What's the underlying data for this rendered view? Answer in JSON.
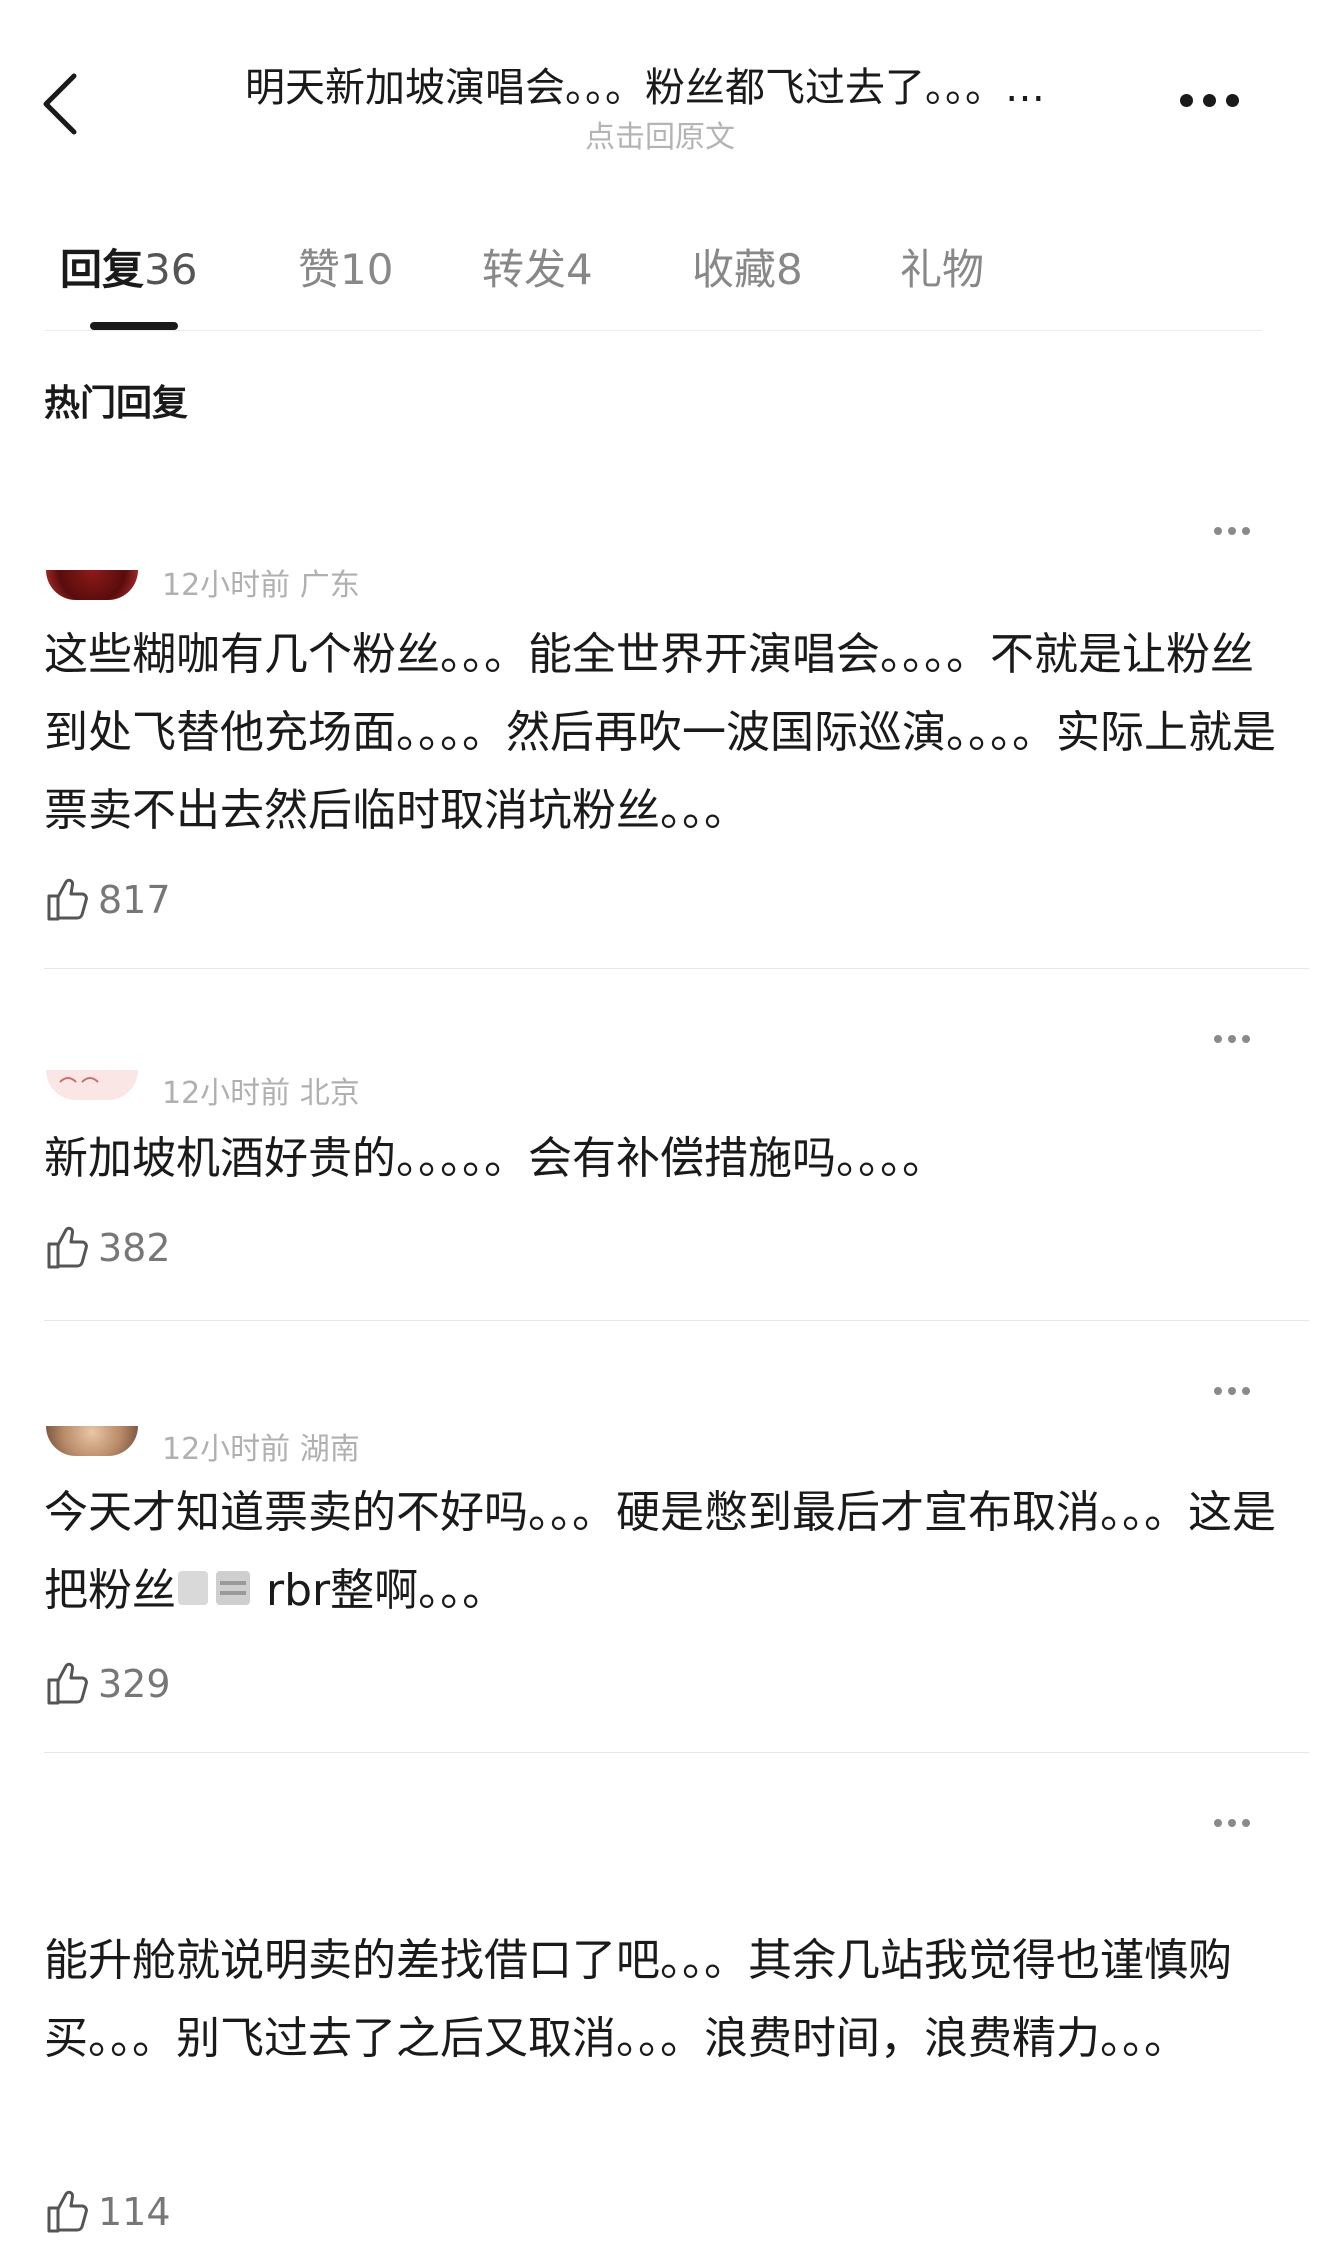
{
  "header": {
    "title": "明天新加坡演唱会。。。粉丝都飞过去了。。。…",
    "subtitle": "点击回原文"
  },
  "tabs": [
    {
      "label": "回复",
      "count": "36"
    },
    {
      "label": "赞",
      "count": "10"
    },
    {
      "label": "转发",
      "count": "4"
    },
    {
      "label": "收藏",
      "count": "8"
    },
    {
      "label": "礼物",
      "count": ""
    }
  ],
  "section_title": "热门回复",
  "comments": [
    {
      "meta": "12小时前  广东",
      "text": "这些糊咖有几个粉丝。。。能全世界开演唱会。。。。不就是让粉丝到处飞替他充场面。。。。然后再吹一波国际巡演。。。。实际上就是票卖不出去然后临时取消坑粉丝。。。",
      "likes": "817"
    },
    {
      "meta": "12小时前  北京",
      "text": "新加坡机酒好贵的。。。。。会有补偿措施吗。。。。",
      "likes": "382"
    },
    {
      "meta": "12小时前  湖南",
      "text_before": "今天才知道票卖的不好吗。。。硬是憋到最后才宣布取消。。。这是把粉丝",
      "text_after": " rbr整啊。。。",
      "likes": "329"
    },
    {
      "meta": "",
      "text": "能升舱就说明卖的差找借口了吧。。。其余几站我觉得也谨慎购买。。。别飞过去了之后又取消。。。浪费时间，浪费精力。。。",
      "likes": "114"
    }
  ],
  "icons": {
    "back": "chevron-left-icon",
    "more": "more-dots-icon",
    "like": "thumbs-up-icon"
  },
  "colors": {
    "text": "#1a1a1a",
    "muted": "#b0b0b0",
    "divider": "#e8e8e8"
  }
}
